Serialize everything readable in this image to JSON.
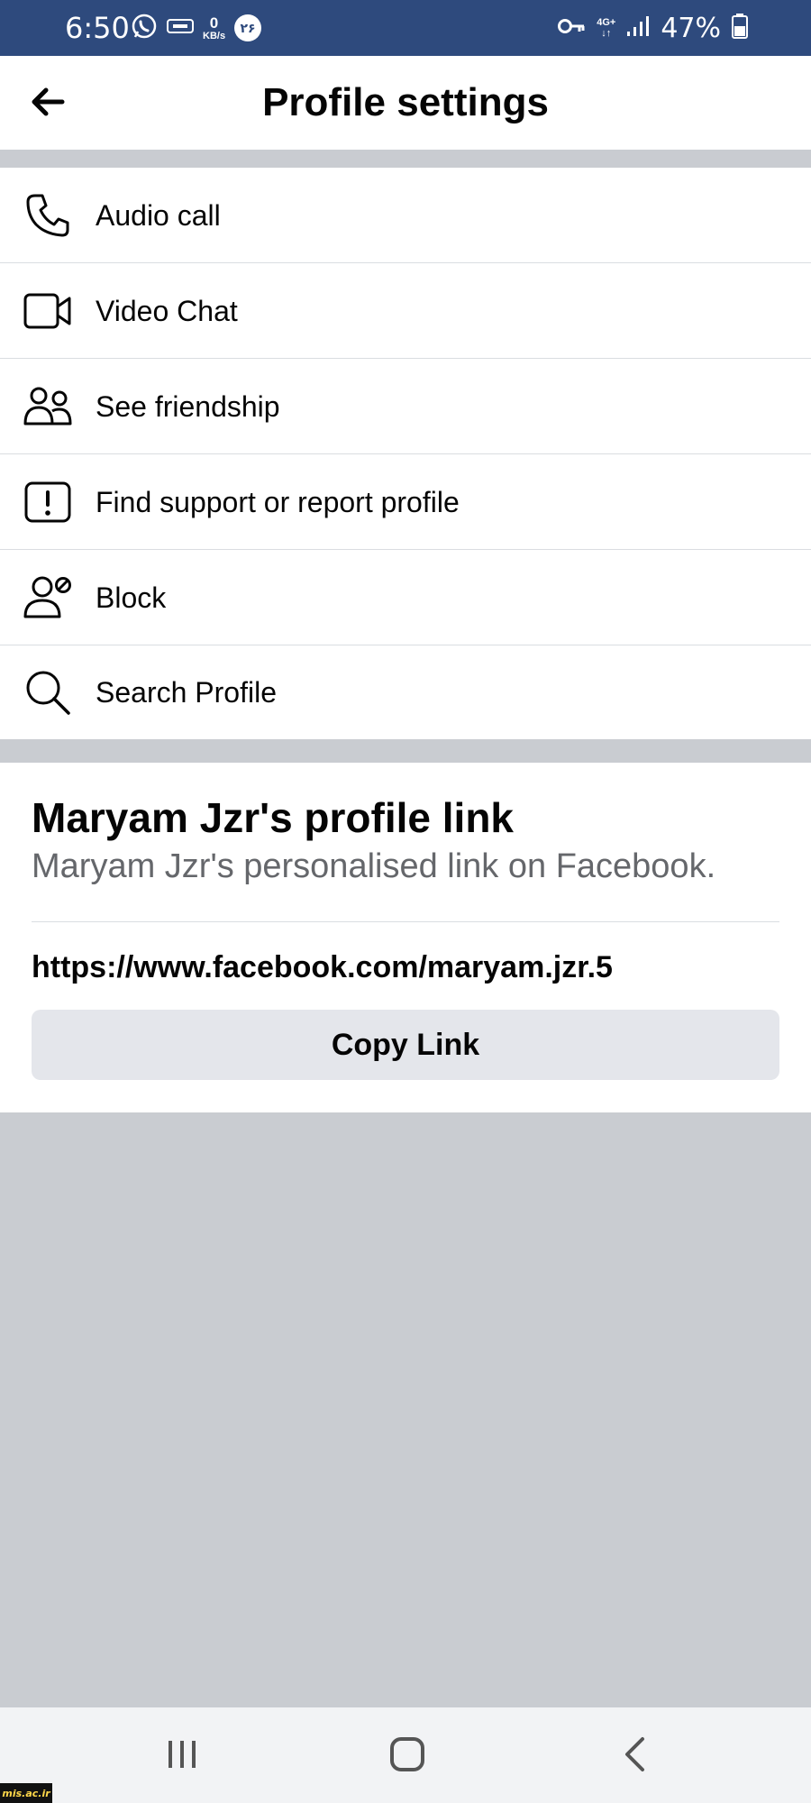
{
  "status_bar": {
    "time": "6:50",
    "speed_value": "0",
    "speed_unit": "KB/s",
    "persian_badge": "۲۶",
    "network_type": "4G+",
    "battery_percent": "47%",
    "icons": [
      "whatsapp-icon",
      "usb-icon",
      "key-icon",
      "signal-icon",
      "battery-icon"
    ]
  },
  "header": {
    "title": "Profile settings",
    "back_icon": "arrow-left-icon"
  },
  "menu": {
    "items": [
      {
        "label": "Audio call",
        "icon": "phone-icon"
      },
      {
        "label": "Video Chat",
        "icon": "video-camera-icon"
      },
      {
        "label": "See friendship",
        "icon": "people-icon"
      },
      {
        "label": "Find support or report profile",
        "icon": "exclamation-box-icon"
      },
      {
        "label": "Block",
        "icon": "block-user-icon"
      },
      {
        "label": "Search Profile",
        "icon": "search-icon"
      }
    ]
  },
  "profile_link": {
    "title": "Maryam Jzr's profile link",
    "subtitle": "Maryam Jzr's personalised link on Facebook.",
    "url": "https://www.facebook.com/maryam.jzr.5",
    "copy_label": "Copy Link"
  },
  "nav_bar": {
    "icons": [
      "recents-icon",
      "home-icon",
      "back-icon"
    ]
  },
  "watermark": {
    "text": "mis.ac.ir"
  },
  "colors": {
    "status_bar": "#2e4a7d",
    "background_gray": "#c9ccd1",
    "text_primary": "#050505",
    "text_secondary": "#65676b",
    "button_gray": "#e4e6eb"
  }
}
